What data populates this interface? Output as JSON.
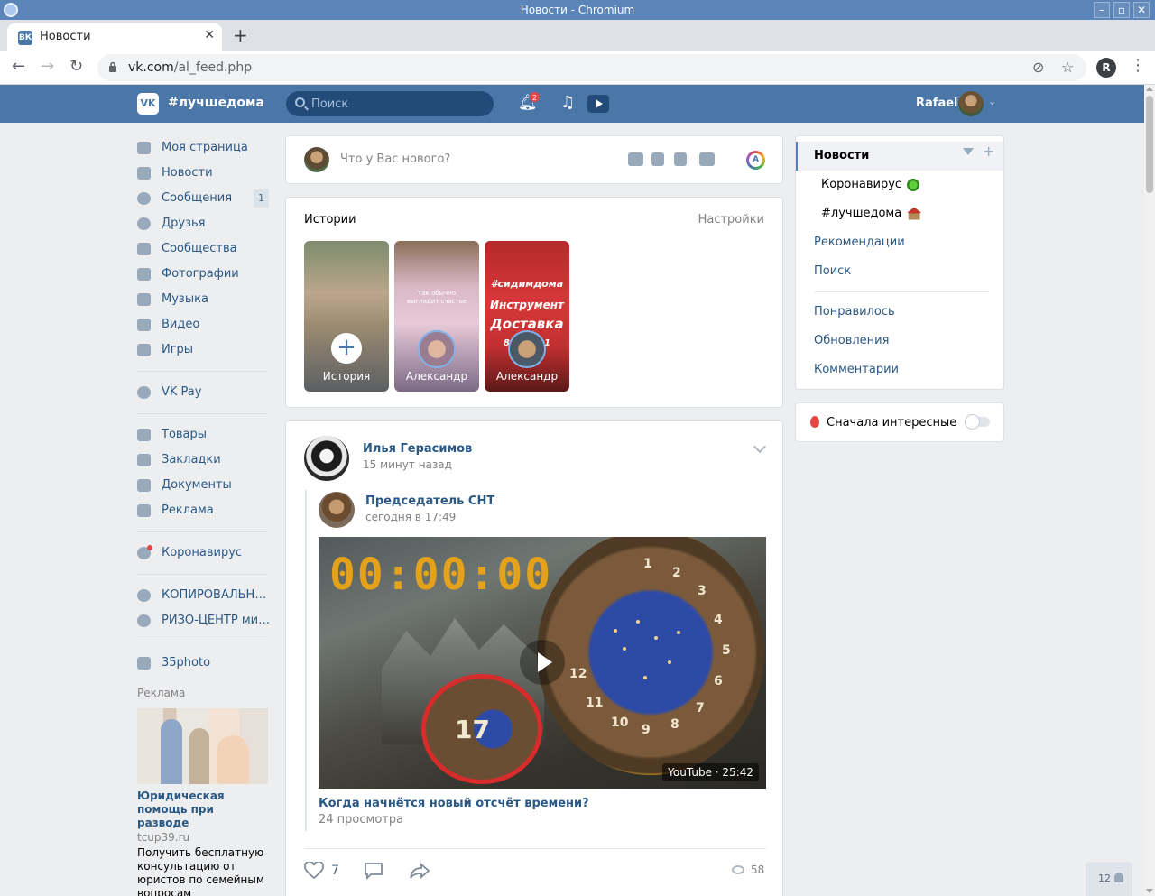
{
  "window": {
    "title": "Новости - Chromium"
  },
  "browser": {
    "tab_title": "Новости",
    "tab_favicon": "ВК",
    "url_domain": "vk.com",
    "url_path": "/al_feed.php",
    "profile_letter": "R"
  },
  "header": {
    "hashtag": "#лучшедома",
    "search_placeholder": "Поиск",
    "notif_count": "2",
    "user_name": "Rafael"
  },
  "sidebar": {
    "items": [
      {
        "label": "Моя страница",
        "icon": "home-icon"
      },
      {
        "label": "Новости",
        "icon": "news-icon"
      },
      {
        "label": "Сообщения",
        "icon": "messages-icon",
        "badge": "1"
      },
      {
        "label": "Друзья",
        "icon": "friends-icon"
      },
      {
        "label": "Сообщества",
        "icon": "communities-icon"
      },
      {
        "label": "Фотографии",
        "icon": "photos-icon"
      },
      {
        "label": "Музыка",
        "icon": "music-icon"
      },
      {
        "label": "Видео",
        "icon": "video-icon"
      },
      {
        "label": "Игры",
        "icon": "games-icon"
      }
    ],
    "pay": "VK Pay",
    "items2": [
      {
        "label": "Товары",
        "icon": "market-icon"
      },
      {
        "label": "Закладки",
        "icon": "bookmark-icon"
      },
      {
        "label": "Документы",
        "icon": "documents-icon"
      },
      {
        "label": "Реклама",
        "icon": "ads-icon"
      }
    ],
    "corona": "Коронавирус",
    "groups": [
      "КОПИРОВАЛЬНЫЙ...",
      "РИЗО-ЦЕНТР мини..."
    ],
    "app": "35photo",
    "ad_label": "Реклама",
    "ad_title": "Юридическая помощь при разводе",
    "ad_domain": "tcup39.ru",
    "ad_text": "Получить бесплатную консультацию от юристов по семейным вопросам"
  },
  "composer": {
    "placeholder": "Что у Вас нового?"
  },
  "stories": {
    "title": "Истории",
    "settings": "Настройки",
    "items": [
      {
        "name": "История"
      },
      {
        "name": "Александр",
        "overlay": "Так обычно выглядит счастье"
      },
      {
        "name": "Александр",
        "line1": "#сидимдома",
        "line2": "Инструмент",
        "line3": "Доставка",
        "line4": "89     021"
      }
    ]
  },
  "post": {
    "author": "Илья Герасимов",
    "time": "15 минут назад",
    "repost_author": "Председатель СНТ",
    "repost_time": "сегодня в 17:49",
    "video_timer": "00:00:00",
    "video_meta": "YouTube · 25:42",
    "video_title": "Когда начнётся новый отсчёт времени?",
    "video_views": "24 просмотра",
    "likes": "7",
    "views": "58"
  },
  "right_menu": {
    "active": "Новости",
    "sub": [
      "Коронавирус",
      "#лучшедома"
    ],
    "items": [
      "Рекомендации",
      "Поиск"
    ],
    "items2": [
      "Понравилось",
      "Обновления",
      "Комментарии"
    ],
    "toggle_label": "Сначала интересные",
    "toggle_on": false
  },
  "chat": {
    "count": "12"
  }
}
